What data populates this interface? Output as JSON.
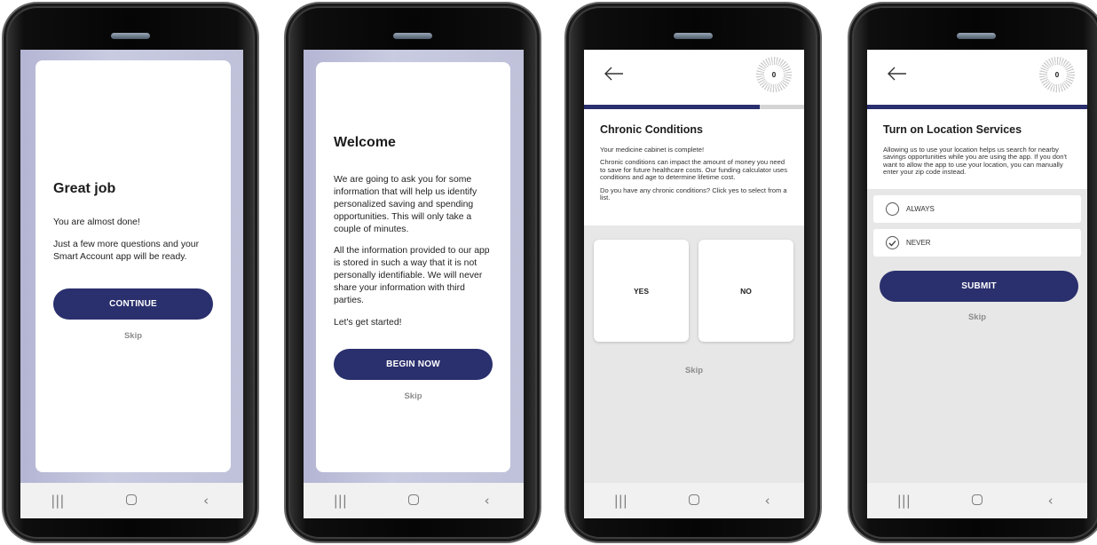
{
  "nav": {
    "recents_icon": "|||",
    "home_icon": "home-square",
    "back_icon": "‹"
  },
  "screen1": {
    "title": "Great job",
    "line1": "You are almost done!",
    "line2": "Just a few more questions and your Smart Account app will be ready.",
    "button": "CONTINUE",
    "skip": "Skip"
  },
  "screen2": {
    "title": "Welcome",
    "para1": "We are going to ask you for some information that will help us identify personalized saving and spending opportunities. This will only take a couple of minutes.",
    "para2": "All the information provided to our app is stored in such a way that it is not personally identifiable. We will never share your information with third parties.",
    "para3": "Let's get started!",
    "button": "BEGIN NOW",
    "skip": "Skip"
  },
  "screen3": {
    "badge": "0",
    "progress": 0.8,
    "title": "Chronic Conditions",
    "p1": "Your medicine cabinet is complete!",
    "p2": "Chronic conditions can impact the amount of money you need to save for future healthcare costs. Our funding calculator uses conditions and age to determine lifetime cost.",
    "p3": "Do you have any chronic conditions? Click yes to select from a list.",
    "yes": "YES",
    "no": "NO",
    "skip": "Skip"
  },
  "screen4": {
    "badge": "0",
    "progress": 1.0,
    "title": "Turn on Location Services",
    "p1": "Allowing us to use your location helps us search for nearby savings opportunities while you are using the app. If you don't want to allow the app to use your location, you can manually enter your zip code instead.",
    "option1": "ALWAYS",
    "option2": "NEVER",
    "button": "SUBMIT",
    "skip": "Skip"
  },
  "colors": {
    "primary": "#2a2f6d",
    "lavender": "#c3c5dd"
  }
}
